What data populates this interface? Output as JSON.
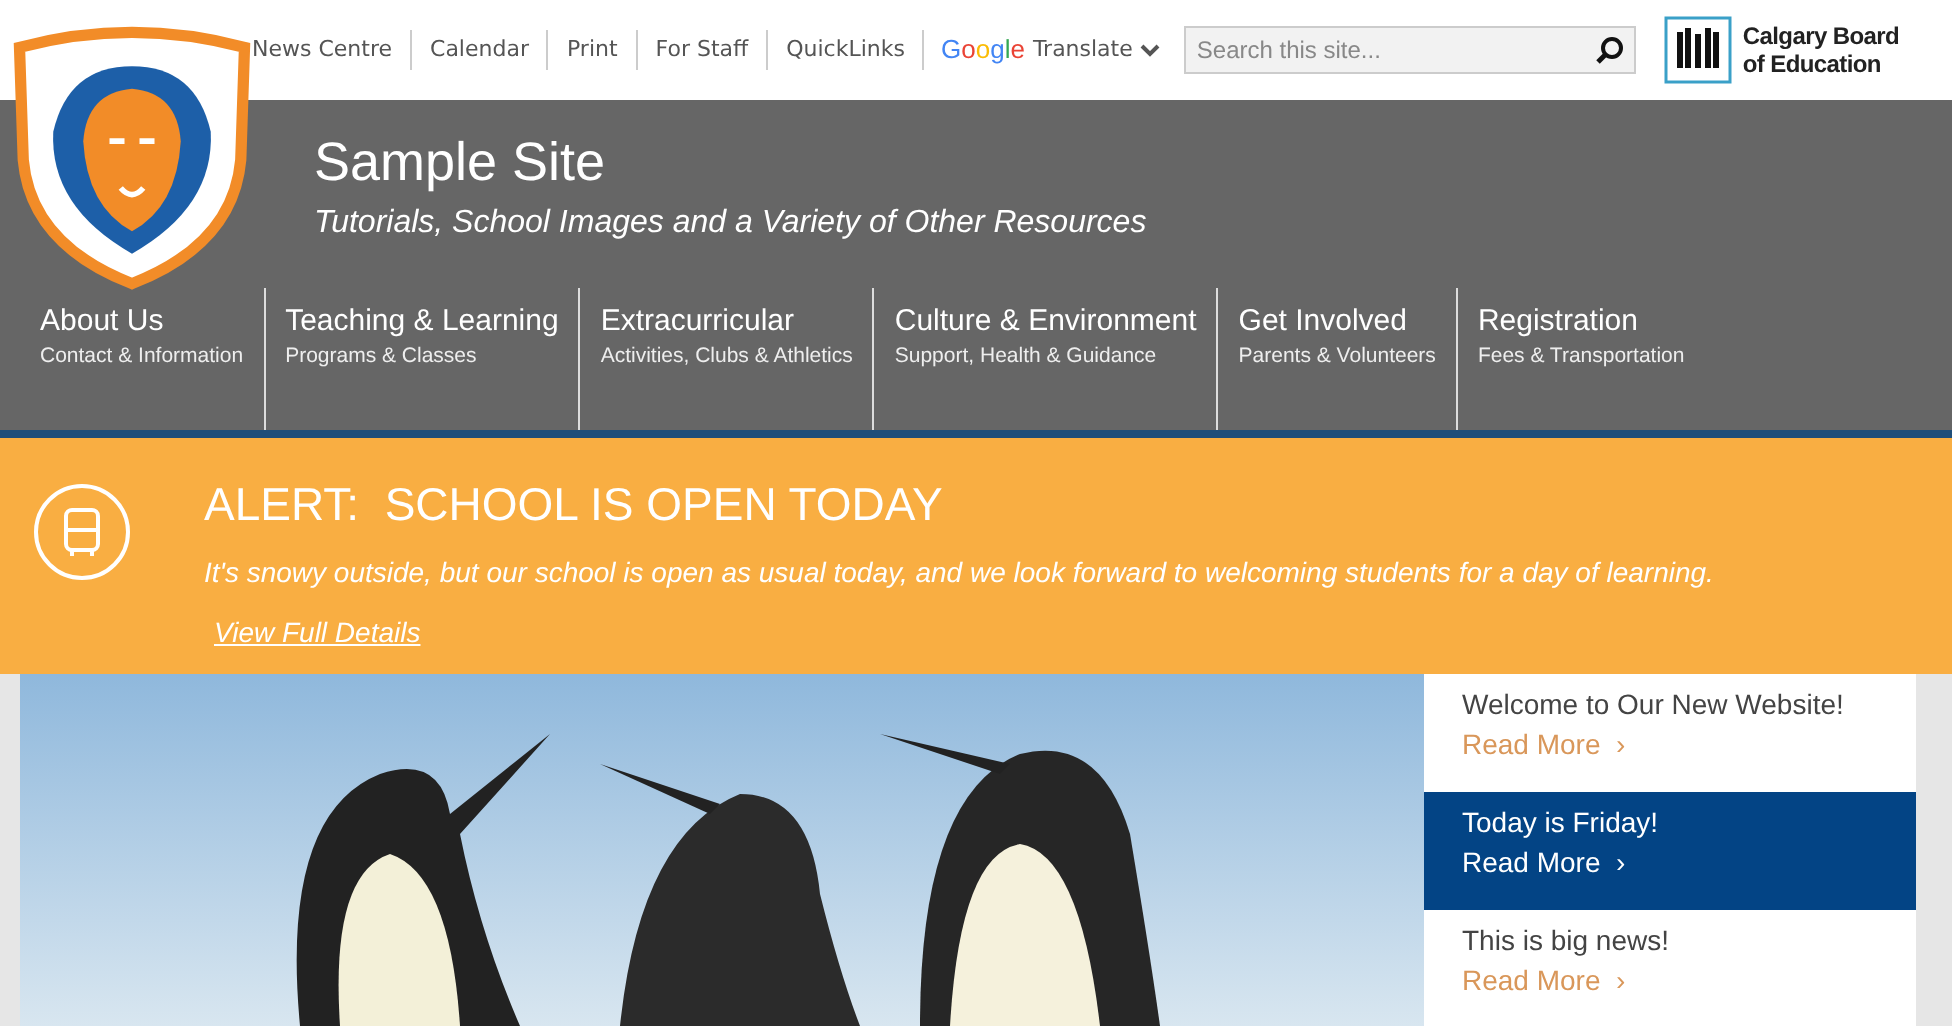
{
  "top_links": [
    "News Centre",
    "Calendar",
    "Print",
    "For Staff",
    "QuickLinks"
  ],
  "translate": {
    "brand": "Google",
    "label": "Translate"
  },
  "search": {
    "placeholder": "Search this site..."
  },
  "board_logo": {
    "line1": "Calgary Board",
    "line2": "of Education"
  },
  "site": {
    "title": "Sample Site",
    "tagline": "Tutorials, School Images and a Variety of Other Resources"
  },
  "nav": [
    {
      "label": "About Us",
      "sub": "Contact & Information"
    },
    {
      "label": "Teaching & Learning",
      "sub": "Programs & Classes"
    },
    {
      "label": "Extracurricular",
      "sub": "Activities, Clubs & Athletics"
    },
    {
      "label": "Culture & Environment",
      "sub": "Support, Health & Guidance"
    },
    {
      "label": "Get Involved",
      "sub": "Parents & Volunteers"
    },
    {
      "label": "Registration",
      "sub": "Fees & Transportation"
    }
  ],
  "alert": {
    "title": "ALERT:  SCHOOL IS OPEN TODAY",
    "message": "It's snowy outside, but our school is open as usual today, and we look forward to welcoming students for a day of learning.",
    "link": "View Full Details"
  },
  "news": [
    {
      "title": "Welcome to Our New Website!",
      "link": "Read More  ›",
      "selected": false
    },
    {
      "title": "Today is Friday!",
      "link": "Read More  ›",
      "selected": true
    },
    {
      "title": "This is big news!",
      "link": "Read More  ›",
      "selected": false
    }
  ]
}
